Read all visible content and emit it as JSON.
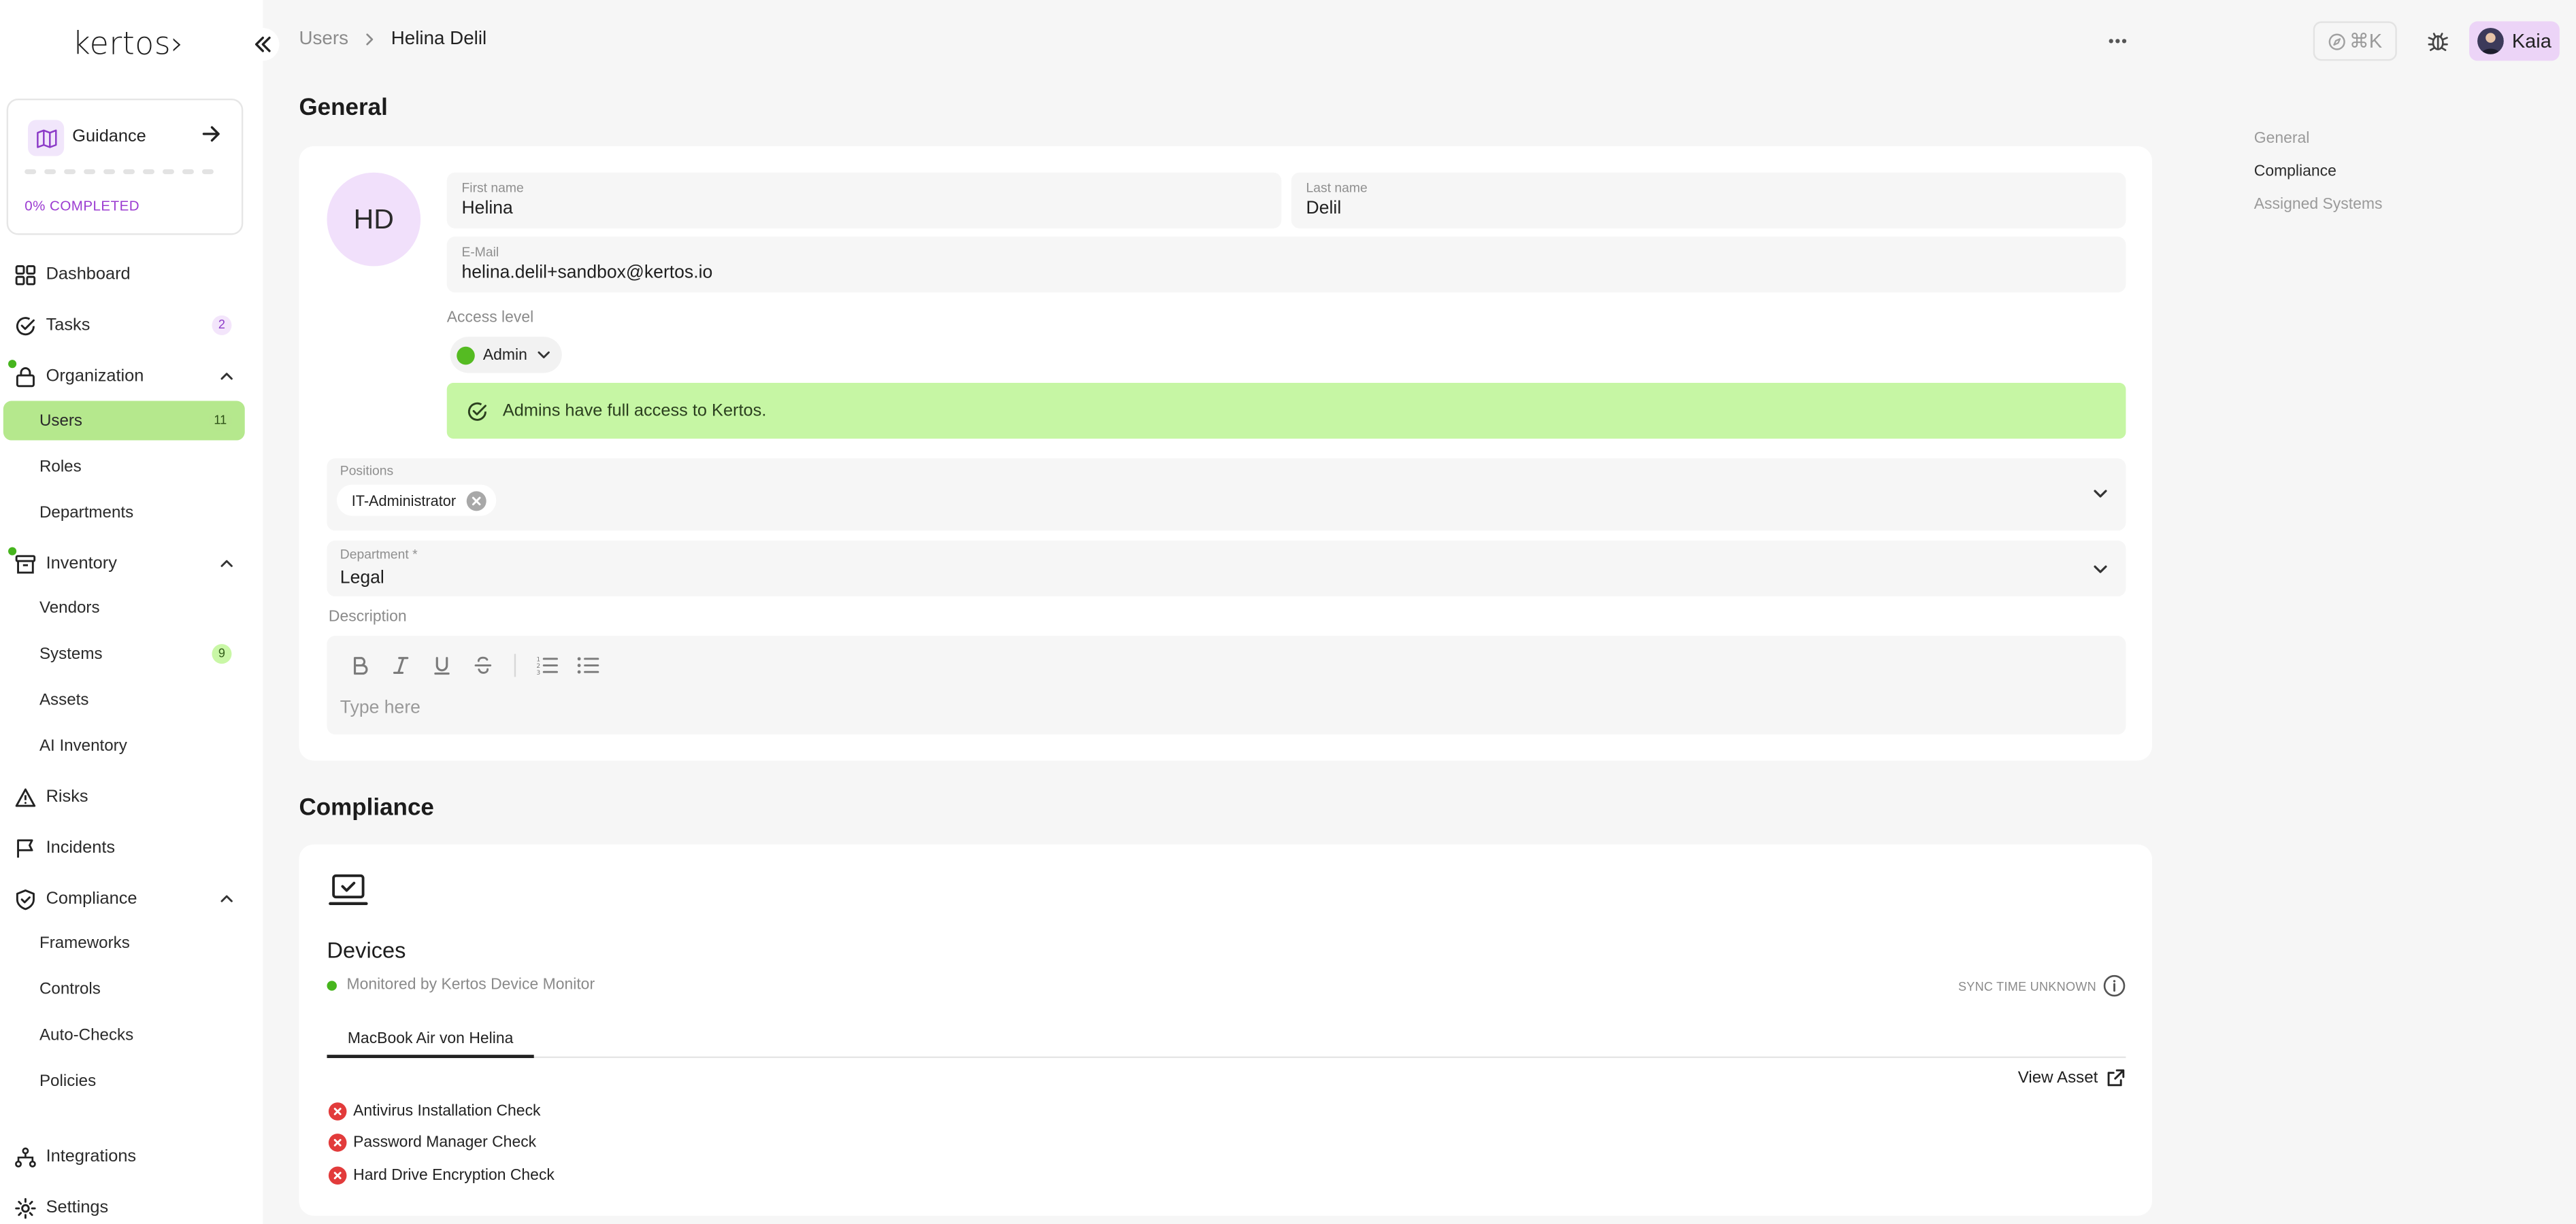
{
  "app": {
    "logo_text": "kertos›",
    "brand_accent": "#b5e88d",
    "brand_purple": "#9b3bd1"
  },
  "sidebar": {
    "guidance": {
      "label": "Guidance",
      "progress_text": "0% COMPLETED",
      "progress_value": 0
    },
    "items": {
      "dashboard": {
        "label": "Dashboard",
        "icon": "dashboard-grid-icon"
      },
      "tasks": {
        "label": "Tasks",
        "badge": "2",
        "icon": "check-circle-icon"
      },
      "organization": {
        "label": "Organization",
        "icon": "lock-icon",
        "expanded": true
      },
      "users": {
        "label": "Users",
        "badge": "11",
        "active": true
      },
      "roles": {
        "label": "Roles"
      },
      "departments": {
        "label": "Departments"
      },
      "inventory": {
        "label": "Inventory",
        "icon": "archive-box-icon",
        "expanded": true
      },
      "vendors": {
        "label": "Vendors"
      },
      "systems": {
        "label": "Systems",
        "badge": "9"
      },
      "assets": {
        "label": "Assets"
      },
      "ai_inventory": {
        "label": "AI Inventory"
      },
      "risks": {
        "label": "Risks",
        "icon": "warning-triangle-icon"
      },
      "incidents": {
        "label": "Incidents",
        "icon": "flag-icon"
      },
      "compliance": {
        "label": "Compliance",
        "icon": "shield-check-icon",
        "expanded": true
      },
      "frameworks": {
        "label": "Frameworks"
      },
      "controls": {
        "label": "Controls"
      },
      "auto_checks": {
        "label": "Auto-Checks"
      },
      "policies": {
        "label": "Policies"
      },
      "integrations": {
        "label": "Integrations",
        "icon": "integrations-tree-icon"
      },
      "settings": {
        "label": "Settings",
        "icon": "gear-icon"
      }
    }
  },
  "topbar": {
    "breadcrumb": [
      "Users",
      "Helina Delil"
    ],
    "command_shortcut": "⌘K",
    "user_name": "Kaia"
  },
  "toc": [
    "General",
    "Compliance",
    "Assigned Systems"
  ],
  "general": {
    "title": "General",
    "avatar_initials": "HD",
    "first_name": {
      "label": "First name",
      "value": "Helina"
    },
    "last_name": {
      "label": "Last name",
      "value": "Delil"
    },
    "email": {
      "label": "E-Mail",
      "value": "helina.delil+sandbox@kertos.io"
    },
    "access_level": {
      "label": "Access level",
      "value": "Admin"
    },
    "notice": "Admins have full access to Kertos.",
    "positions": {
      "label": "Positions",
      "chips": [
        "IT-Administrator"
      ]
    },
    "department": {
      "label": "Department *",
      "value": "Legal"
    },
    "description": {
      "label": "Description",
      "placeholder": "Type here"
    }
  },
  "compliance": {
    "title": "Compliance",
    "devices_title": "Devices",
    "monitor_text": "Monitored by Kertos Device Monitor",
    "sync_text": "SYNC TIME UNKNOWN",
    "tabs": [
      "MacBook Air von Helina"
    ],
    "view_asset": "View Asset",
    "checks": [
      {
        "label": "Antivirus Installation Check",
        "status": "failed"
      },
      {
        "label": "Password Manager Check",
        "status": "failed"
      },
      {
        "label": "Hard Drive Encryption Check",
        "status": "failed"
      }
    ]
  }
}
